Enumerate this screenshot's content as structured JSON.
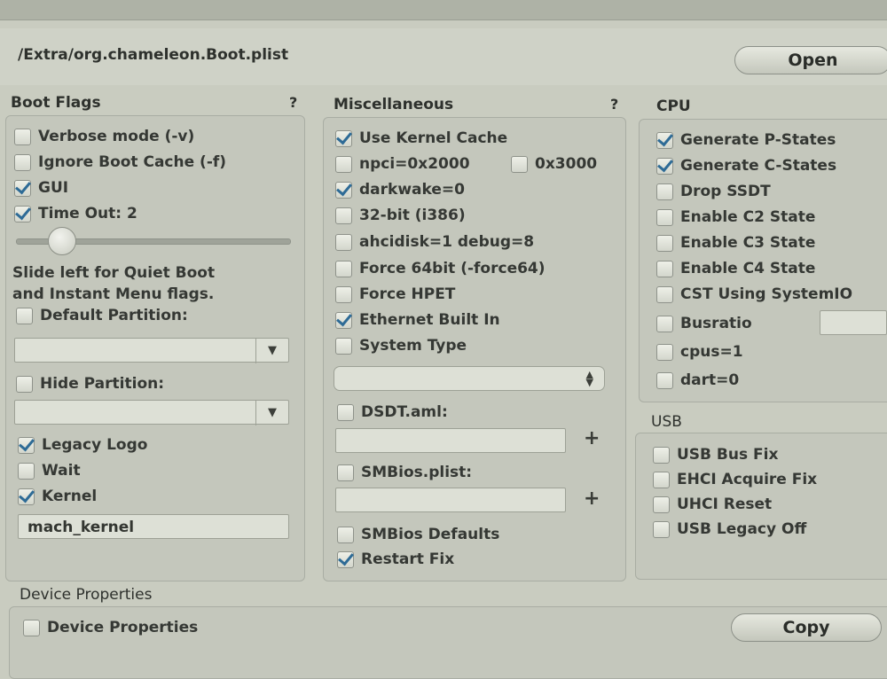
{
  "header": {
    "path": "/Extra/org.chameleon.Boot.plist",
    "open_label": "Open"
  },
  "boot_flags": {
    "title": "Boot Flags",
    "help": "?",
    "verbose": {
      "label": "Verbose mode (-v)",
      "checked": false
    },
    "ignore_cache": {
      "label": "Ignore Boot Cache (-f)",
      "checked": false
    },
    "gui": {
      "label": "GUI",
      "checked": true
    },
    "timeout": {
      "label": "Time Out: 2",
      "checked": true
    },
    "timeout_slider_level": 0.13,
    "note_line1": "Slide left for Quiet Boot",
    "note_line2": "and Instant Menu flags.",
    "default_partition": {
      "label": "Default Partition:",
      "checked": false,
      "value": ""
    },
    "hide_partition": {
      "label": "Hide Partition:",
      "checked": false,
      "value": ""
    },
    "legacy_logo": {
      "label": "Legacy Logo",
      "checked": true
    },
    "wait": {
      "label": "Wait",
      "checked": false
    },
    "kernel": {
      "label": "Kernel",
      "checked": true
    },
    "kernel_value": "mach_kernel"
  },
  "misc": {
    "title": "Miscellaneous",
    "help": "?",
    "use_kernel_cache": {
      "label": "Use Kernel Cache",
      "checked": true
    },
    "npci_2000": {
      "label": "npci=0x2000",
      "checked": false
    },
    "npci_3000": {
      "label": "0x3000",
      "checked": false
    },
    "darkwake": {
      "label": "darkwake=0",
      "checked": true
    },
    "bit32": {
      "label": "32-bit (i386)",
      "checked": false
    },
    "ahcidisk": {
      "label": "ahcidisk=1 debug=8",
      "checked": false
    },
    "force64": {
      "label": "Force 64bit (-force64)",
      "checked": false
    },
    "force_hpet": {
      "label": "Force HPET",
      "checked": false
    },
    "ethernet": {
      "label": "Ethernet Built In",
      "checked": true
    },
    "system_type": {
      "label": "System Type",
      "checked": false,
      "value": ""
    },
    "dsdt": {
      "label": "DSDT.aml:",
      "checked": false,
      "value": ""
    },
    "smbios_plist": {
      "label": "SMBios.plist:",
      "checked": false,
      "value": ""
    },
    "plus_label": "+",
    "smbios_defaults": {
      "label": "SMBios Defaults",
      "checked": false
    },
    "restart_fix": {
      "label": "Restart Fix",
      "checked": true
    }
  },
  "cpu": {
    "title": "CPU",
    "pstates": {
      "label": "Generate P-States",
      "checked": true
    },
    "cstates": {
      "label": "Generate C-States",
      "checked": true
    },
    "drop_ssdt": {
      "label": "Drop SSDT",
      "checked": false
    },
    "c2": {
      "label": "Enable C2 State",
      "checked": false
    },
    "c3": {
      "label": "Enable C3 State",
      "checked": false
    },
    "c4": {
      "label": "Enable C4 State",
      "checked": false
    },
    "cst": {
      "label": "CST Using SystemIO",
      "checked": false
    },
    "busratio": {
      "label": "Busratio",
      "checked": false,
      "value": ""
    },
    "cpus": {
      "label": "cpus=1",
      "checked": false
    },
    "dart": {
      "label": "dart=0",
      "checked": false
    }
  },
  "usb": {
    "title": "USB",
    "bus_fix": {
      "label": "USB Bus Fix",
      "checked": false
    },
    "ehci": {
      "label": "EHCI Acquire Fix",
      "checked": false
    },
    "uhci": {
      "label": "UHCI Reset",
      "checked": false
    },
    "legacy_off": {
      "label": "USB Legacy Off",
      "checked": false
    }
  },
  "device": {
    "title": "Device Properties",
    "checkbox": {
      "label": "Device Properties",
      "checked": false
    },
    "copy_label": "Copy"
  }
}
